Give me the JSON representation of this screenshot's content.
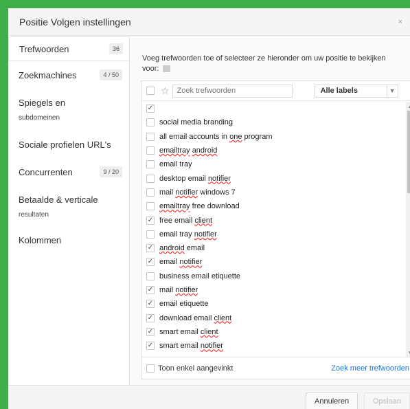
{
  "dialog": {
    "title": "Positie Volgen instellingen",
    "close_glyph": "×"
  },
  "sidebar": {
    "items": [
      {
        "label": "Trefwoorden",
        "count": "36"
      },
      {
        "label": "Zoekmachines",
        "count": "4 / 50"
      },
      {
        "label": "Spiegels en",
        "sub": "subdomeinen"
      },
      {
        "label": "Sociale profielen URL's"
      },
      {
        "label": "Concurrenten",
        "count": "9 / 20"
      },
      {
        "label": "Betaalde & verticale",
        "sub": "resultaten"
      },
      {
        "label": "Kolommen"
      }
    ]
  },
  "main": {
    "intro": "Voeg trefwoorden toe of selecteer ze hieronder om uw positie te bekijken voor:",
    "search": {
      "placeholder": "Zoek trefwoorden",
      "value": ""
    },
    "labels_select": {
      "value": "Alle labels"
    },
    "keywords": [
      {
        "text": "",
        "checked": true
      },
      {
        "text": "social media branding",
        "checked": false
      },
      {
        "text": "all email accounts in one program",
        "checked": false
      },
      {
        "text": "emailtray android",
        "checked": false
      },
      {
        "text": "email tray",
        "checked": false
      },
      {
        "text": "desktop email notifier",
        "checked": false
      },
      {
        "text": "mail notifier windows 7",
        "checked": false
      },
      {
        "text": "emailtray free download",
        "checked": false
      },
      {
        "text": "free email client",
        "checked": true
      },
      {
        "text": "email tray notifier",
        "checked": false
      },
      {
        "text": "android email",
        "checked": true
      },
      {
        "text": "email notifier",
        "checked": true
      },
      {
        "text": "business email etiquette",
        "checked": false
      },
      {
        "text": "mail notifier",
        "checked": true
      },
      {
        "text": "email etiquette",
        "checked": true
      },
      {
        "text": "download email client",
        "checked": true
      },
      {
        "text": "smart email client",
        "checked": true
      },
      {
        "text": "smart email notifier",
        "checked": true
      }
    ],
    "show_checked_only": "Toon enkel aangevinkt",
    "find_more": "Zoek meer trefwoorden"
  },
  "footer": {
    "cancel_label": "Annuleren",
    "save_label": "Opslaan"
  }
}
